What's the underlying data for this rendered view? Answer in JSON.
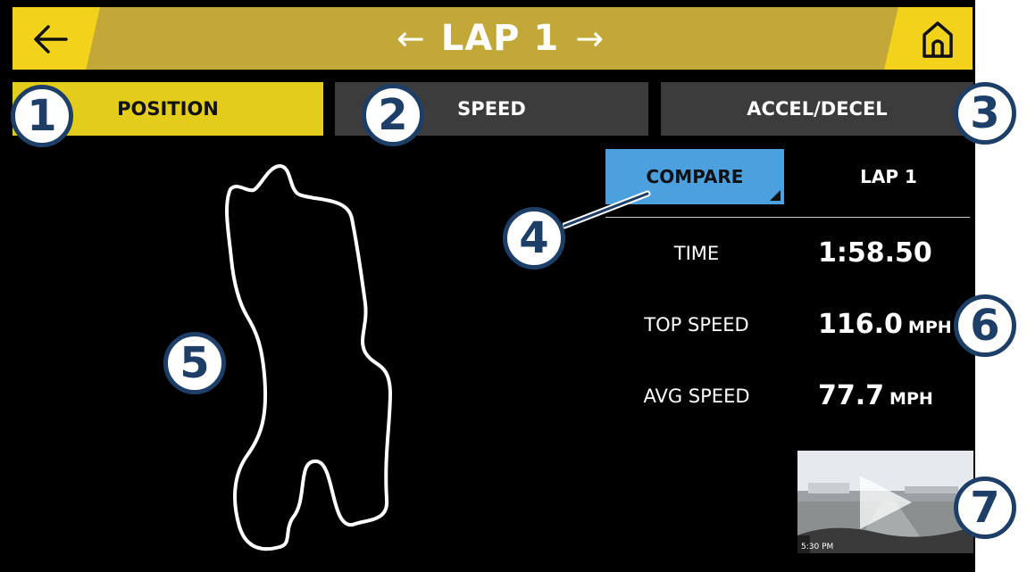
{
  "header": {
    "back_icon": "arrow-left-icon",
    "prev_arrow": "←",
    "title": "LAP 1",
    "next_arrow": "→",
    "home_icon": "home-icon",
    "colors": {
      "bar": "#c2a838",
      "accent": "#f2d21a"
    }
  },
  "tabs": [
    {
      "label": "POSITION",
      "selected": true
    },
    {
      "label": "SPEED",
      "selected": false
    },
    {
      "label": "ACCEL/DECEL",
      "selected": false
    }
  ],
  "compare": {
    "button_label": "COMPARE",
    "lap_label": "LAP 1",
    "button_color": "#4ca0dd"
  },
  "stats": [
    {
      "label": "TIME",
      "value": "1:58.50",
      "unit": ""
    },
    {
      "label": "TOP SPEED",
      "value": "116.0",
      "unit": "MPH"
    },
    {
      "label": "AVG SPEED",
      "value": "77.7",
      "unit": "MPH"
    }
  ],
  "video": {
    "play_icon": "play-icon",
    "overlay_text": "5:30 PM"
  },
  "track_map": {
    "icon": "track-map-icon"
  },
  "callouts": [
    "1",
    "2",
    "3",
    "4",
    "5",
    "6",
    "7"
  ]
}
